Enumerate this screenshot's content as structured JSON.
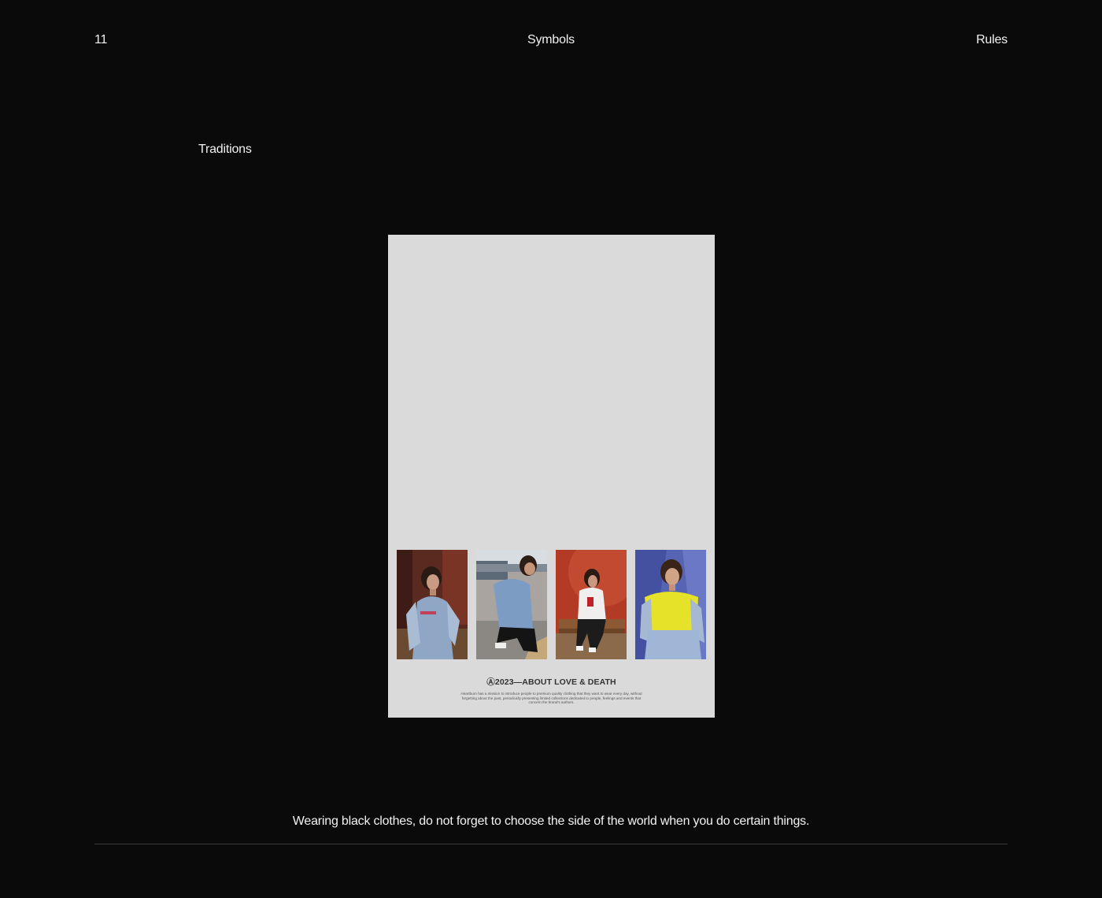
{
  "nav": {
    "page_number": "11",
    "center_link": "Symbols",
    "right_link": "Rules"
  },
  "section": {
    "label": "Traditions"
  },
  "poster": {
    "title": "Ⓐ2023—ABOUT LOVE & DEATH",
    "body": "Heartburn has a mission to introduce people to premium quality clothing that they want to wear every day, without forgetting about the past, periodically presenting limited collections dedicated to people, feelings and events that concern the brand's authors.",
    "photos": [
      {
        "subject": "woman in light denim outfit seated before a red wooden door"
      },
      {
        "subject": "person crouching in a blue hoodie, seen from behind"
      },
      {
        "subject": "woman in white hoodie seated on a bench against a red wall"
      },
      {
        "subject": "woman in yellow t-shirt and denim against a blue backdrop"
      }
    ]
  },
  "caption": {
    "text": "Wearing black clothes, do not forget to choose the side of the world when you do certain things."
  },
  "colors": {
    "background": "#0a0a0a",
    "text": "#f2f2f2",
    "poster_background": "#dadada",
    "divider": "#3a3a3a"
  }
}
